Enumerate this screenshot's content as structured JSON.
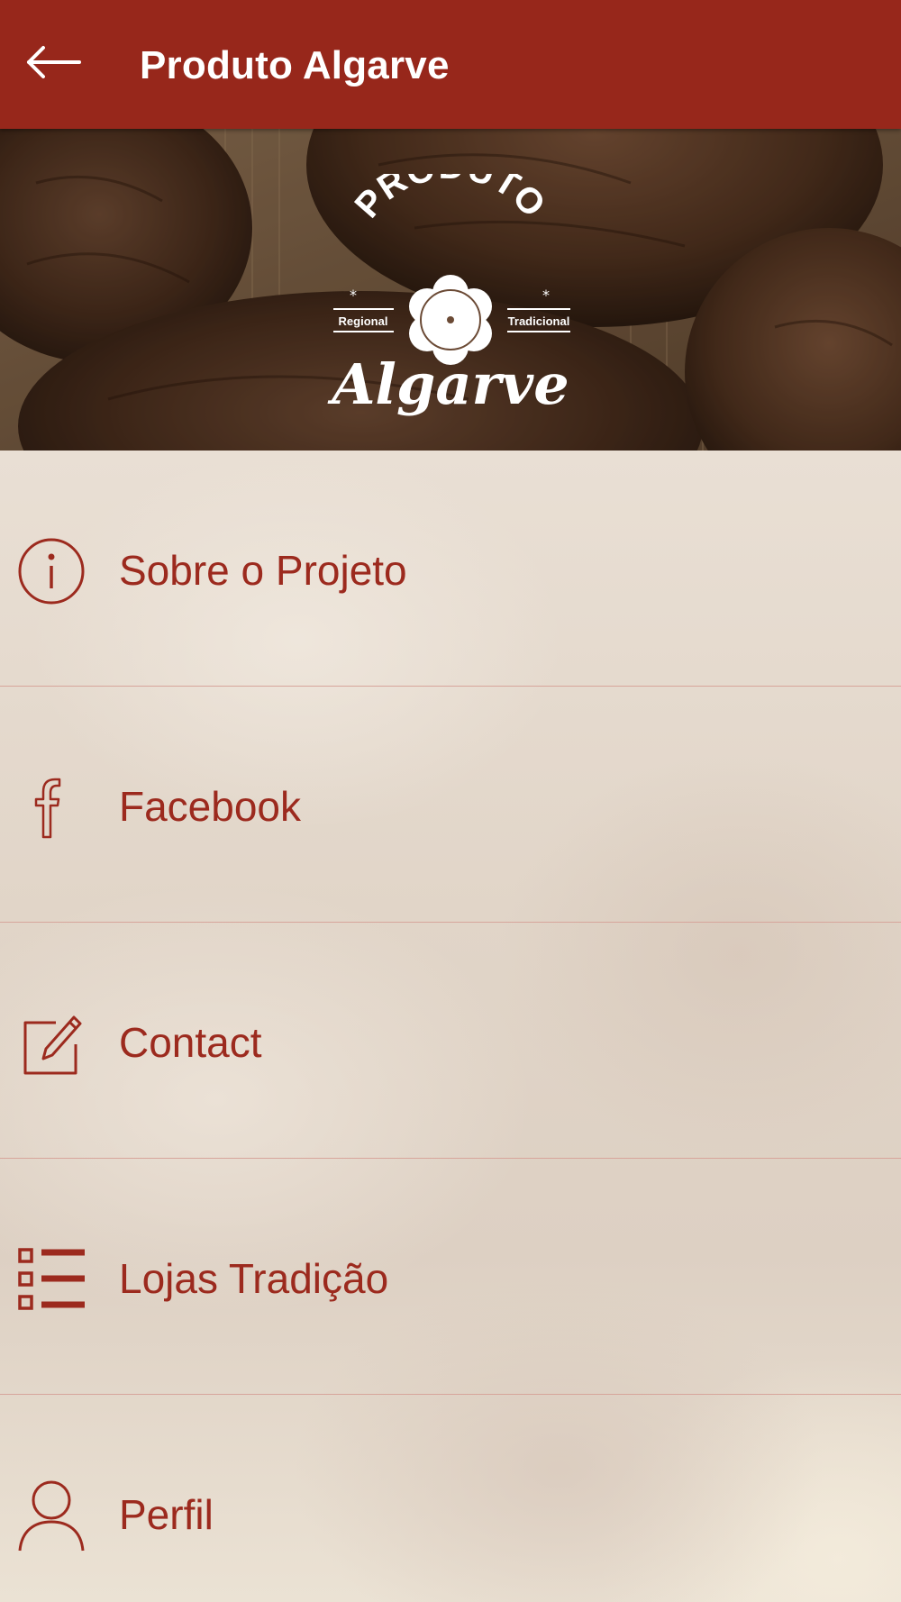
{
  "app_bar": {
    "title": "Produto Algarve",
    "back_icon": "arrow-left-icon",
    "background_color": "#97271b",
    "text_color": "#ffffff"
  },
  "hero": {
    "logo": {
      "top_text": "PRODUTO",
      "left_text": "Regional",
      "right_text": "Tradicional",
      "bottom_text": "Algarve"
    }
  },
  "menu": {
    "accent_color": "#9c2a1e",
    "items": [
      {
        "label": "Sobre o Projeto",
        "icon": "info-circle-icon"
      },
      {
        "label": "Facebook",
        "icon": "facebook-icon"
      },
      {
        "label": "Contact",
        "icon": "edit-icon"
      },
      {
        "label": "Lojas Tradição",
        "icon": "list-icon"
      },
      {
        "label": "Perfil",
        "icon": "user-icon"
      }
    ]
  }
}
